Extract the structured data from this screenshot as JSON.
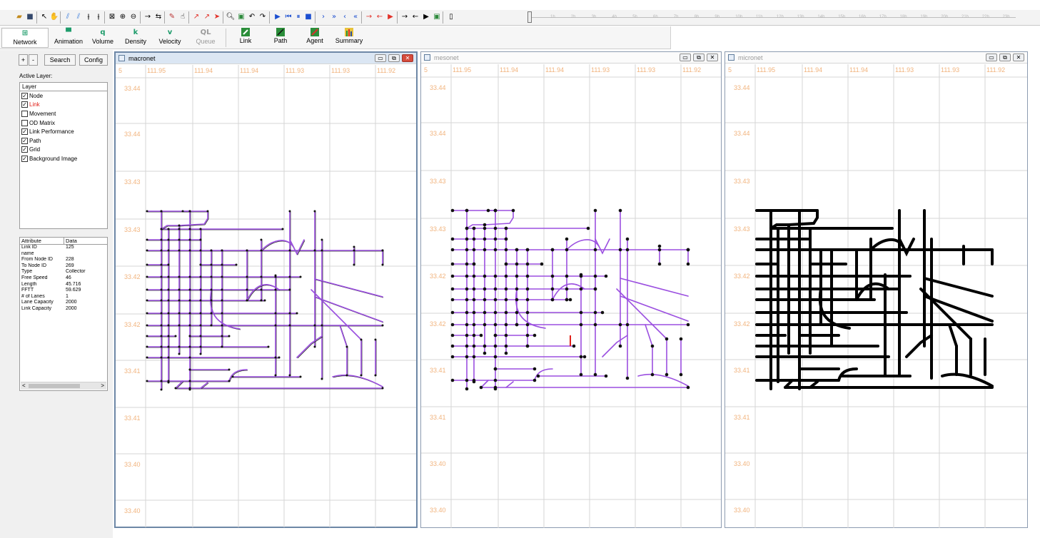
{
  "toolbar": {
    "hour_labels": [
      "1h",
      "2h",
      "3h",
      "4h",
      "5h",
      "6h",
      "7h",
      "8h",
      "9h",
      "10h",
      "11h",
      "12h",
      "13h",
      "14h",
      "15h",
      "16h",
      "17h",
      "18h",
      "19h",
      "20h",
      "21h",
      "22h",
      "23h"
    ]
  },
  "ribbon": {
    "items": [
      {
        "label": "Network",
        "icon": "network-icon",
        "glyph": "⊞",
        "active": true
      },
      {
        "label": "Animation",
        "icon": "animation-icon",
        "glyph": "▀"
      },
      {
        "label": "Volume",
        "icon": "volume-icon",
        "glyph": "q"
      },
      {
        "label": "Density",
        "icon": "density-icon",
        "glyph": "k"
      },
      {
        "label": "Velocity",
        "icon": "velocity-icon",
        "glyph": "v"
      },
      {
        "label": "Queue",
        "icon": "queue-icon",
        "glyph": "QL",
        "disabled": true
      },
      {
        "label": "Link",
        "icon": "link-icon"
      },
      {
        "label": "Path",
        "icon": "path-icon"
      },
      {
        "label": "Agent",
        "icon": "agent-icon"
      },
      {
        "label": "Summary",
        "icon": "summary-icon"
      }
    ]
  },
  "left_panel": {
    "zoom_in": "+",
    "zoom_out": "-",
    "search_label": "Search",
    "config_label": "Config",
    "active_layer_label": "Active Layer:",
    "layer_header": "Layer",
    "layers": [
      {
        "name": "Node",
        "checked": true
      },
      {
        "name": "Link",
        "checked": true,
        "active": true
      },
      {
        "name": "Movement",
        "checked": false
      },
      {
        "name": "OD Matrix",
        "checked": false
      },
      {
        "name": "Link Performance",
        "checked": true
      },
      {
        "name": "Path",
        "checked": true
      },
      {
        "name": "Grid",
        "checked": true
      },
      {
        "name": "Background Image",
        "checked": true
      }
    ],
    "attr_headers": [
      "Attribute",
      "Data"
    ],
    "attributes": [
      [
        "Link ID",
        "125"
      ],
      [
        "name",
        ""
      ],
      [
        "From Node ID",
        "228"
      ],
      [
        "To Node ID",
        "269"
      ],
      [
        "Type",
        "Collector"
      ],
      [
        "Free Speed",
        "46"
      ],
      [
        "Length",
        "45.716"
      ],
      [
        "FFTT",
        "59.629"
      ],
      [
        "# of Lanes",
        "1"
      ],
      [
        "Lane Capacity",
        "2000"
      ],
      [
        "Link Capacity",
        "2000"
      ]
    ],
    "scroll_left": "<",
    "scroll_right": ">"
  },
  "views": [
    {
      "id": "macronet",
      "title": "macronet",
      "active": true,
      "x_labels": [
        "111.95",
        "111.94",
        "111.94",
        "111.93",
        "111.93",
        "111.92"
      ]
    },
    {
      "id": "mesonet",
      "title": "mesonet",
      "active": false,
      "x_labels": [
        "111.95",
        "111.94",
        "111.94",
        "111.93",
        "111.93",
        "111.92"
      ]
    },
    {
      "id": "micronet",
      "title": "micronet",
      "active": false,
      "x_labels": [
        "111.95",
        "111.94",
        "111.94",
        "111.93",
        "111.93",
        "111.92"
      ]
    }
  ],
  "map": {
    "x_edge_label": "5",
    "y_labels": [
      "33.44",
      "33.44",
      "33.43",
      "33.43",
      "33.42",
      "33.42",
      "33.41",
      "33.41",
      "33.40",
      "33.40"
    ],
    "link_color": "#9b4fe0",
    "highlight_color": "#e0201a",
    "micro_link_color": "#000000",
    "grid_color": "#d6d6d6",
    "label_color": "#f1b37d"
  }
}
